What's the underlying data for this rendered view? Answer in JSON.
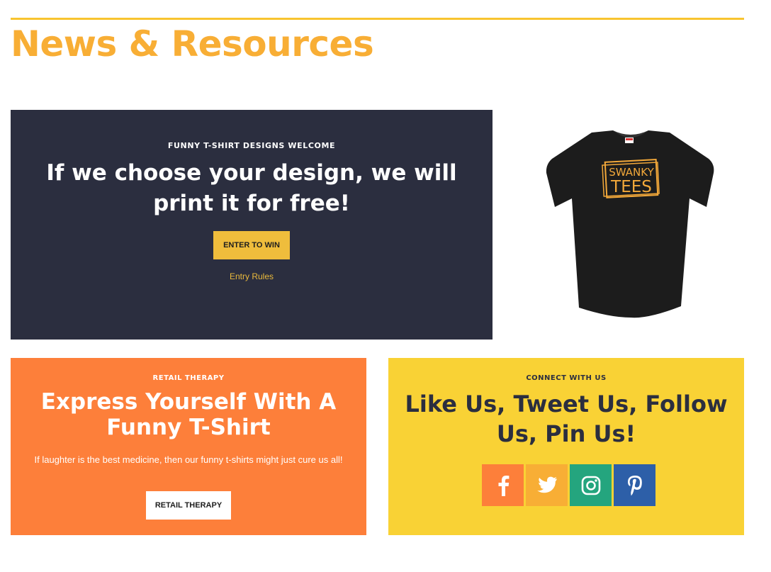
{
  "section": {
    "title": "News & Resources",
    "accent_color": "#f8c42f",
    "title_color": "#f8ae35"
  },
  "hero": {
    "eyebrow": "FUNNY T-SHIRT DESIGNS WELCOME",
    "headline": "If we choose your design, we will print it for free!",
    "cta_label": "ENTER TO WIN",
    "rules_link": "Entry Rules",
    "background": "#2b2e3f",
    "cta_color": "#efbd3c"
  },
  "product_image": {
    "icon": "t-shirt-image",
    "shirt_text_line1": "SWANKY",
    "shirt_text_line2": "TEES"
  },
  "retail_card": {
    "eyebrow": "RETAIL THERAPY",
    "headline": "Express Yourself With A Funny T-Shirt",
    "body": "If laughter is the best medicine, then our funny t-shirts might just cure us all!",
    "cta_label": "RETAIL THERAPY",
    "background": "#fd7f3a"
  },
  "social_card": {
    "eyebrow": "CONNECT WITH US",
    "headline": "Like Us, Tweet Us, Follow Us, Pin Us!",
    "background": "#f9d235",
    "networks": [
      {
        "name": "facebook",
        "icon": "facebook-icon",
        "color": "#fd7f3a"
      },
      {
        "name": "twitter",
        "icon": "twitter-icon",
        "color": "#f8ae35"
      },
      {
        "name": "instagram",
        "icon": "instagram-icon",
        "color": "#24a57e"
      },
      {
        "name": "pinterest",
        "icon": "pinterest-icon",
        "color": "#2d5fa8"
      }
    ]
  }
}
